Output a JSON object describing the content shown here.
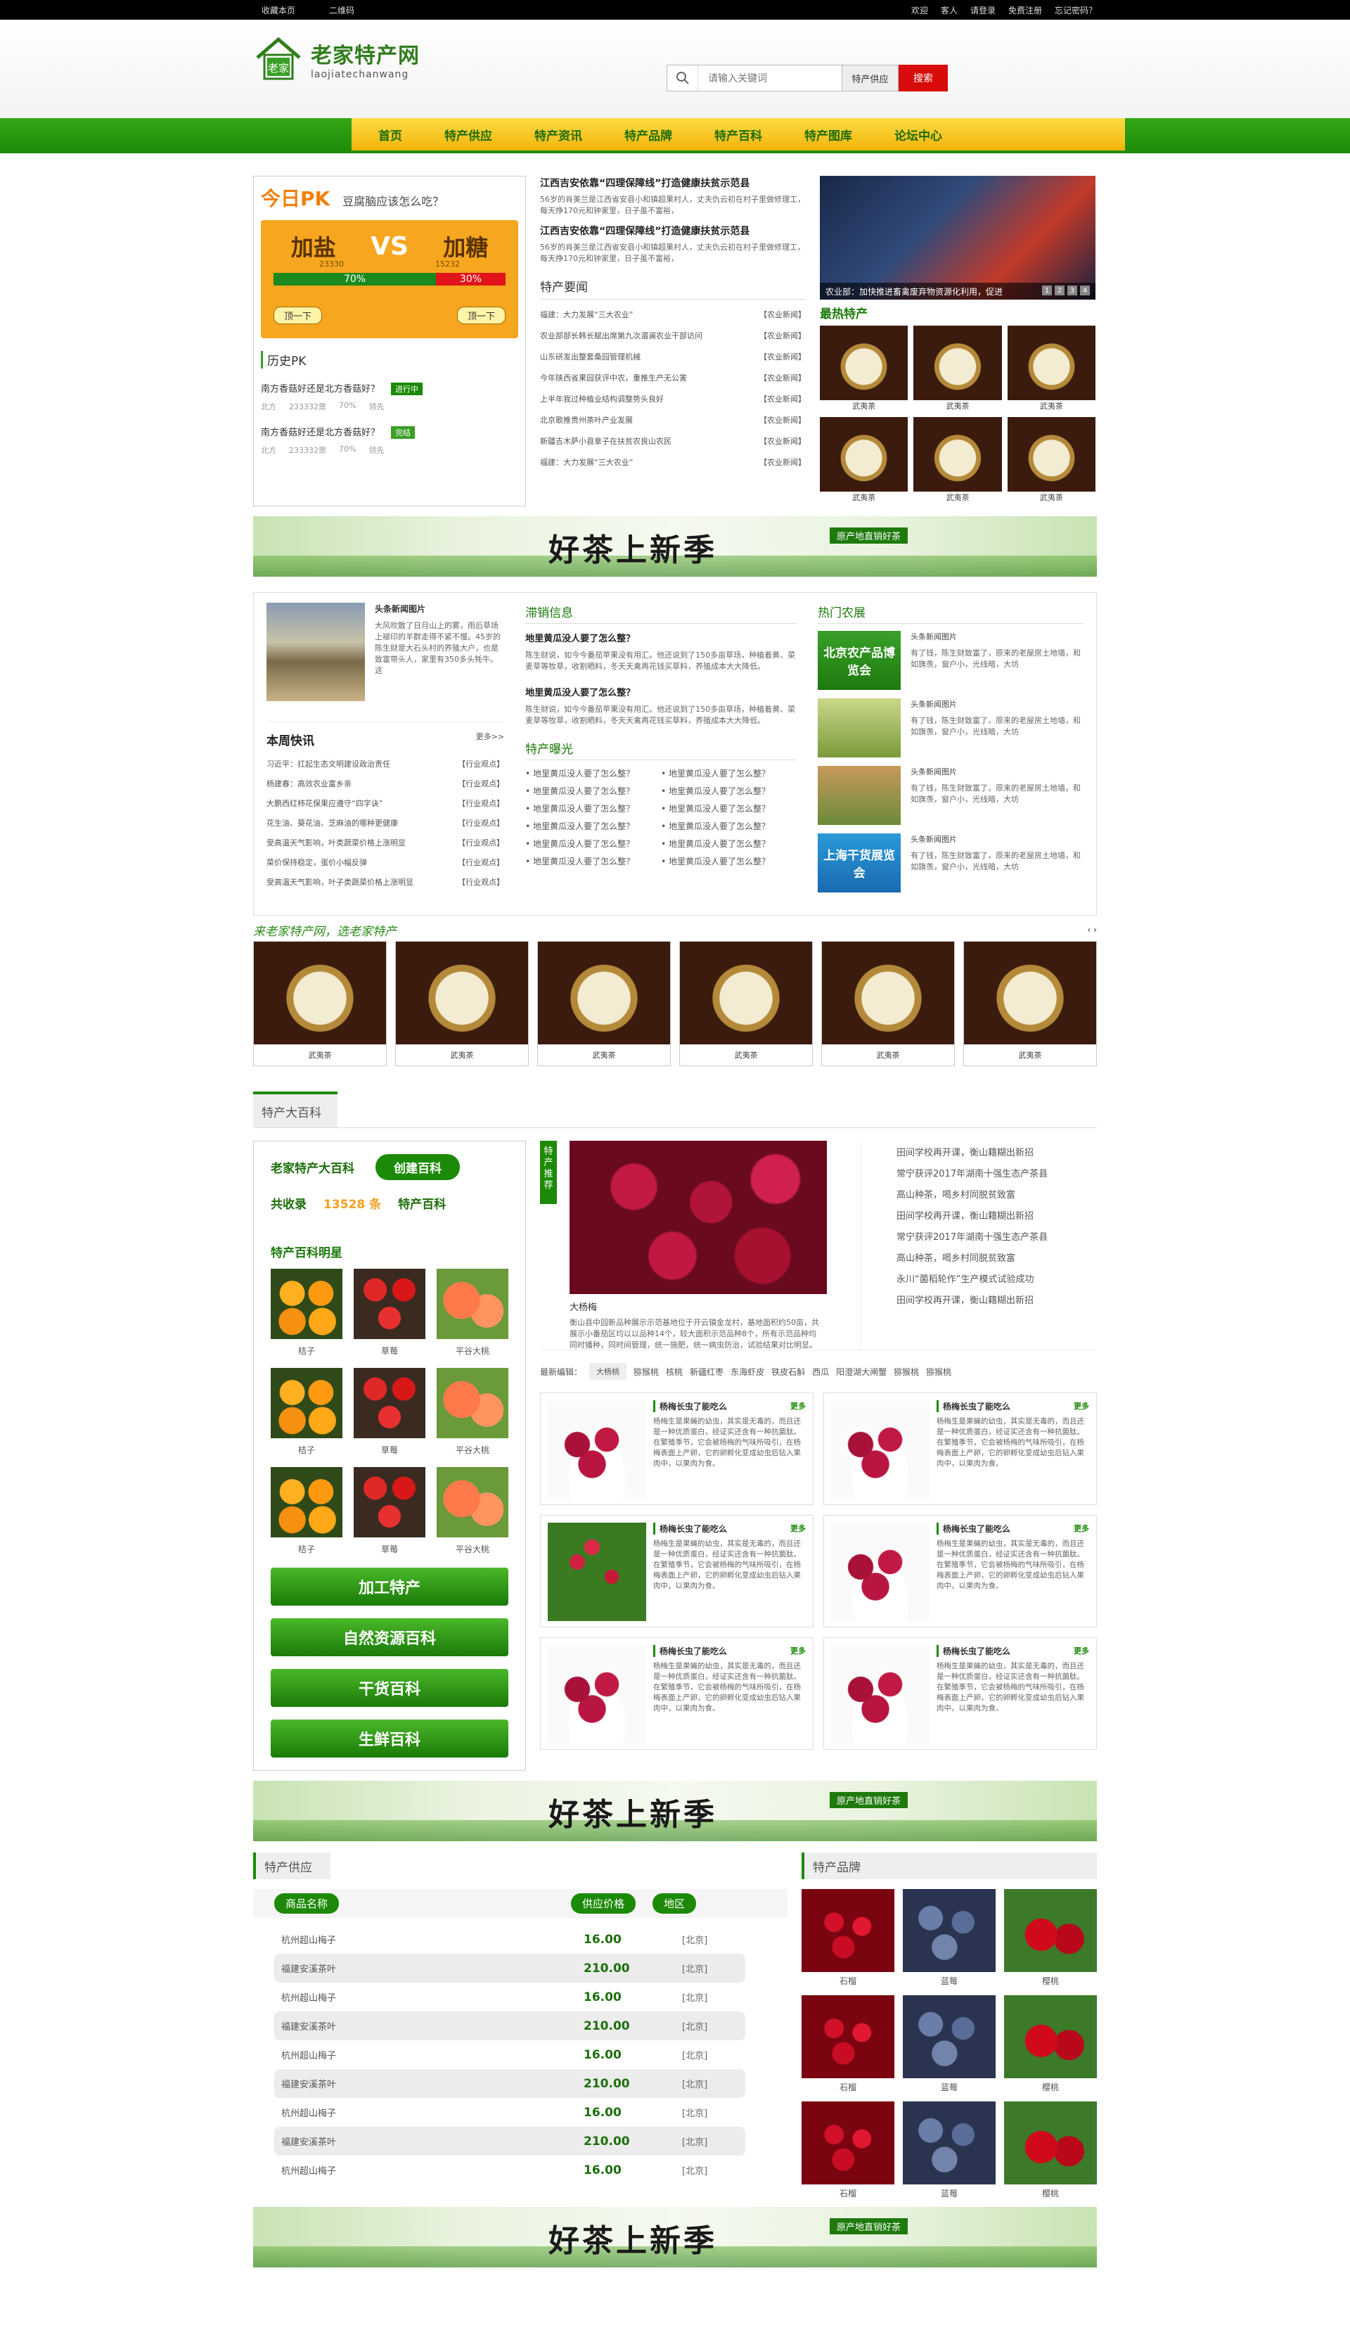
{
  "topbar": {
    "left": [
      "收藏本页",
      "二维码"
    ],
    "right": [
      "欢迎",
      "客人",
      "请登录",
      "免费注册",
      "忘记密码？"
    ]
  },
  "logo": {
    "cn": "老家特产网",
    "en": "laojiatechanwang",
    "mark": "老家"
  },
  "search": {
    "placeholder": "请输入关键词",
    "category": "特产供应",
    "button": "搜索"
  },
  "nav": [
    "首页",
    "特产供应",
    "特产资讯",
    "特产品牌",
    "特产百科",
    "特产图库",
    "论坛中心"
  ],
  "pk": {
    "title": "今日PK",
    "question": "豆腐脑应该怎么吃？",
    "left": "加盐",
    "right": "加糖",
    "vs": "VS",
    "left_num": "23330",
    "right_num": "15232",
    "left_pct": "70%",
    "right_pct": "30%",
    "left_value": 0.7,
    "btn": "顶一下",
    "history_title": "历史PK",
    "history": [
      {
        "q": "南方香菇好还是北方香菇好？",
        "status": "进行中",
        "side": "北方",
        "votes": "233332票",
        "pct": "70%",
        "lead": "领先"
      },
      {
        "q": "南方香菇好还是北方香菇好？",
        "status": "完结",
        "side": "北方",
        "votes": "233332票",
        "pct": "70%",
        "lead": "领先"
      }
    ]
  },
  "news1": [
    {
      "title": "江西吉安依靠“四理保障线”打造健康扶贫示范县",
      "body": "56岁的肖美兰是江西省安县小和镇超果村人，丈夫仇云初在村子里做修理工，每天挣170元和钟家里，日子虽不富裕，"
    },
    {
      "title": "江西吉安依靠“四理保障线”打造健康扶贫示范县",
      "body": "56岁的肖美兰是江西省安县小和镇超果村人，丈夫仇云初在村子里做修理工，每天挣170元和钟家里，日子虽不富裕，"
    }
  ],
  "special_news": {
    "title": "特产要闻",
    "items": [
      [
        "福建：大力发展“三大农业”",
        "【农业新闻】"
      ],
      [
        "农业部部长韩长赋出席第九次湄澜农业干部访问",
        "【农业新闻】"
      ],
      [
        "山东研发出整套桑园管理机械",
        "【农业新闻】"
      ],
      [
        "今年陕西省果园获评中农，重推生产无公害",
        "【农业新闻】"
      ],
      [
        "上半年我过种植业结构调整势头良好",
        "【农业新闻】"
      ],
      [
        "北京歌推贵州茶叶产业发展",
        "【农业新闻】"
      ],
      [
        "新疆吉木萨小县拿子在扶贫农良山农民",
        "【农业新闻】"
      ],
      [
        "福建：大力发展“三大农业”",
        "【农业新闻】"
      ]
    ]
  },
  "slide": {
    "caption": "农业部：加快推进畜禽废弃物资源化利用，促进",
    "pages": [
      "1",
      "2",
      "3",
      "4"
    ]
  },
  "hot": {
    "title": "最热特产",
    "items": [
      "武夷茶",
      "武夷茶",
      "武夷茶",
      "武夷茶",
      "武夷茶",
      "武夷茶"
    ]
  },
  "banner": {
    "text": "好茶上新季",
    "tag": "原产地直销好茶"
  },
  "headline": {
    "label": "头条新闻图片",
    "body": "大风吹散了日月山上的雾，雨后草场上褪印的羊群走得不紧不慢。45岁的陈生财是大石头村的养殖大户，也是致富带头人，家里有350多头牦牛。这"
  },
  "week": {
    "title": "本周快讯",
    "more": "更多>>",
    "items": [
      [
        "习近平：扛起生态文明建设政治责任",
        "【行业观点】"
      ],
      [
        "杨建春：高效农业富乡亲",
        "【行业观点】"
      ],
      [
        "大鹏西红柿花保果应遵守“四字诀”",
        "【行业观点】"
      ],
      [
        "花生油、葵花油、芝麻油的哪种更健康",
        "【行业观点】"
      ],
      [
        "受高温天气影响，叶类蔬菜价格上涨明显",
        "【行业观点】"
      ],
      [
        "菜价保持稳定，蛋价小幅反弹",
        "【行业观点】"
      ],
      [
        "受高温天气影响，叶子类蔬菜价格上涨明显",
        "【行业观点】"
      ]
    ]
  },
  "sales": {
    "title": "滞销信息",
    "items": [
      {
        "h": "地里黄瓜没人要了怎么整？",
        "p": "陈生财说，如今今番茄苹果没有用汇。他还说到了150多亩草场，种植着黄、菜麦草等牧草，收割晒料，冬天天禽再花钱买草料，养殖成本大大降低。"
      },
      {
        "h": "地里黄瓜没人要了怎么整？",
        "p": "陈生财说，如今今番茄苹果没有用汇。他还说到了150多亩草场，种植着黄、菜麦草等牧草，收割晒料，冬天天禽再花钱买草料，养殖成本大大降低。"
      }
    ]
  },
  "expose": {
    "title": "特产曝光",
    "items": [
      "地里黄瓜没人要了怎么整？",
      "地里黄瓜没人要了怎么整？",
      "地里黄瓜没人要了怎么整？",
      "地里黄瓜没人要了怎么整？",
      "地里黄瓜没人要了怎么整？",
      "地里黄瓜没人要了怎么整？",
      "地里黄瓜没人要了怎么整？",
      "地里黄瓜没人要了怎么整？",
      "地里黄瓜没人要了怎么整？",
      "地里黄瓜没人要了怎么整？",
      "地里黄瓜没人要了怎么整？",
      "地里黄瓜没人要了怎么整？"
    ]
  },
  "farm": {
    "title": "热门农展",
    "items": [
      {
        "img": "北京农产品博览会",
        "label": "头条新闻图片",
        "p": "有了钱，陈生财致富了，原来的老屋房土地墙，和如旗羡，窗户小，光线暗，大坊"
      },
      {
        "img": "",
        "label": "头条新闻图片",
        "p": "有了钱，陈生财致富了，原来的老屋房土地墙，和如旗羡，窗户小，光线暗，大坊"
      },
      {
        "img": "",
        "label": "头条新闻图片",
        "p": "有了钱，陈生财致富了，原来的老屋房土地墙，和如旗羡，窗户小，光线暗，大坊"
      },
      {
        "img": "上海干货展览会",
        "label": "头条新闻图片",
        "p": "有了钱，陈生财致富了，原来的老屋房土地墙，和如旗羡，窗户小，光线暗，大坊"
      }
    ]
  },
  "strip": {
    "slogan": "来老家特产网，选老家特产",
    "arrows": "‹ ›",
    "items": [
      "武夷茶",
      "武夷茶",
      "武夷茶",
      "武夷茶",
      "武夷茶",
      "武夷茶"
    ]
  },
  "baike": {
    "tab": "特产大百科",
    "name": "老家特产大百科",
    "create": "创建百科",
    "total_label": "共收录",
    "total": "13528",
    "unit": "条",
    "total_suffix": "特产百科",
    "star": "特产百科明星",
    "fruits": [
      {
        "n": "桔子",
        "c": "orange"
      },
      {
        "n": "草莓",
        "c": "straw"
      },
      {
        "n": "平谷大桃",
        "c": "peach"
      },
      {
        "n": "桔子",
        "c": "orange"
      },
      {
        "n": "草莓",
        "c": "straw"
      },
      {
        "n": "平谷大桃",
        "c": "peach"
      },
      {
        "n": "桔子",
        "c": "orange"
      },
      {
        "n": "草莓",
        "c": "straw"
      },
      {
        "n": "平谷大桃",
        "c": "peach"
      }
    ],
    "buttons": [
      "加工特产",
      "自然资源百科",
      "干货百科",
      "生鲜百科"
    ],
    "vtag": "特产推荐",
    "main_title": "大杨梅",
    "main_body": "衡山县中园新品种展示示范基地位于开云镇金龙村，基地面积约50亩，共展示小番茄区均以以品种14个，较大面积示范品种8个，所有示范品种均同时播种，同时间管理，统一施肥，统一病虫防治，试验结果对比明显。",
    "side": [
      "田间学校再开课，衡山籍糊出新招",
      "常宁获评2017年湖南十强生态产茶县",
      "高山种茶，喝乡村同脱贫致富",
      "田间学校再开课，衡山籍糊出新招",
      "常宁获评2017年湖南十强生态产茶县",
      "高山种茶，喝乡村同脱贫致富",
      "永川“菌稻轮作”生产模式试验成功",
      "田间学校再开课，衡山籍糊出新招"
    ],
    "latest_label": "最新编辑：",
    "latest": [
      "大杨桃",
      "猕猴桃",
      "核桃",
      "新疆红枣",
      "东海虾皮",
      "铁皮石斛",
      "西瓜",
      "阳澄湖大闸蟹",
      "猕猴桃",
      "猕猴桃"
    ],
    "cards": [
      {
        "t": "杨梅长虫了能吃么",
        "more": "更多",
        "p": "杨梅生是果蝇的幼虫，其实是无毒的，而且还是一种优质蛋白，经证实还含有一种抗菌肽。在繁殖季节，它会被杨梅的气味所吸引，在杨梅表面上产卵，它的卵孵化变成幼虫后钻入果肉中，以果肉为食。",
        "img": ""
      },
      {
        "t": "杨梅长虫了能吃么",
        "more": "更多",
        "p": "杨梅生是果蝇的幼虫，其实是无毒的，而且还是一种优质蛋白，经证实还含有一种抗菌肽。在繁殖季节，它会被杨梅的气味所吸引，在杨梅表面上产卵，它的卵孵化变成幼虫后钻入果肉中，以果肉为食。",
        "img": ""
      },
      {
        "t": "杨梅长虫了能吃么",
        "more": "更多",
        "p": "杨梅生是果蝇的幼虫，其实是无毒的，而且还是一种优质蛋白，经证实还含有一种抗菌肽。在繁殖季节，它会被杨梅的气味所吸引，在杨梅表面上产卵，它的卵孵化变成幼虫后钻入果肉中，以果肉为食。",
        "img": "tree"
      },
      {
        "t": "杨梅长虫了能吃么",
        "more": "更多",
        "p": "杨梅生是果蝇的幼虫，其实是无毒的，而且还是一种优质蛋白，经证实还含有一种抗菌肽。在繁殖季节，它会被杨梅的气味所吸引，在杨梅表面上产卵，它的卵孵化变成幼虫后钻入果肉中，以果肉为食。",
        "img": ""
      },
      {
        "t": "杨梅长虫了能吃么",
        "more": "更多",
        "p": "杨梅生是果蝇的幼虫，其实是无毒的，而且还是一种优质蛋白，经证实还含有一种抗菌肽。在繁殖季节，它会被杨梅的气味所吸引，在杨梅表面上产卵，它的卵孵化变成幼虫后钻入果肉中，以果肉为食。",
        "img": ""
      },
      {
        "t": "杨梅长虫了能吃么",
        "more": "更多",
        "p": "杨梅生是果蝇的幼虫，其实是无毒的，而且还是一种优质蛋白，经证实还含有一种抗菌肽。在繁殖季节，它会被杨梅的气味所吸引，在杨梅表面上产卵，它的卵孵化变成幼虫后钻入果肉中，以果肉为食。",
        "img": ""
      }
    ]
  },
  "supply": {
    "title": "特产供应",
    "cols": [
      "商品名称",
      "供应价格",
      "地区"
    ],
    "rows": [
      [
        "杭州超山梅子",
        "16.00",
        "[北京]"
      ],
      [
        "福建安溪茶叶",
        "210.00",
        "[北京]"
      ],
      [
        "杭州超山梅子",
        "16.00",
        "[北京]"
      ],
      [
        "福建安溪茶叶",
        "210.00",
        "[北京]"
      ],
      [
        "杭州超山梅子",
        "16.00",
        "[北京]"
      ],
      [
        "福建安溪茶叶",
        "210.00",
        "[北京]"
      ],
      [
        "杭州超山梅子",
        "16.00",
        "[北京]"
      ],
      [
        "福建安溪茶叶",
        "210.00",
        "[北京]"
      ],
      [
        "杭州超山梅子",
        "16.00",
        "[北京]"
      ]
    ]
  },
  "brand": {
    "title": "特产品牌",
    "items": [
      {
        "n": "石榴",
        "c": "pom"
      },
      {
        "n": "蓝莓",
        "c": "blue"
      },
      {
        "n": "樱桃",
        "c": "cher"
      },
      {
        "n": "石榴",
        "c": "pom"
      },
      {
        "n": "蓝莓",
        "c": "blue"
      },
      {
        "n": "樱桃",
        "c": "cher"
      },
      {
        "n": "石榴",
        "c": "pom"
      },
      {
        "n": "蓝莓",
        "c": "blue"
      },
      {
        "n": "樱桃",
        "c": "cher"
      }
    ]
  },
  "colors": {
    "green": "#1c8a08",
    "orange": "#f7a620",
    "red": "#d80c0c"
  }
}
